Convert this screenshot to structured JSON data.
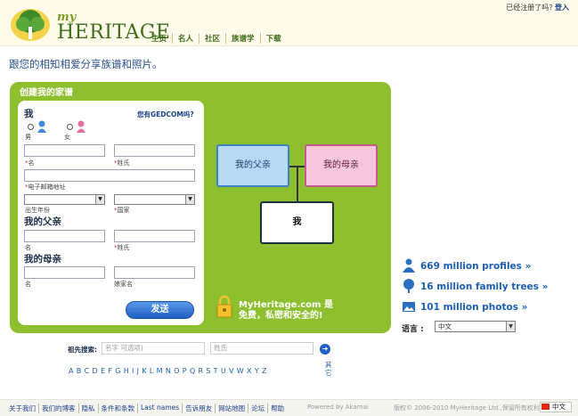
{
  "header": {
    "logo_my": "my",
    "logo_heritage": "HERITAGE",
    "nav": [
      "主页",
      "名人",
      "社区",
      "族谱学",
      "下载"
    ],
    "account_question": "已经注册了吗?",
    "login": "登入"
  },
  "tagline": "跟您的相知相爱分享族谱和照片。",
  "panel": {
    "title": "创建我的家谱",
    "gedcom_link": "您有GEDCOM吗?",
    "me_heading": "我",
    "male": "男",
    "female": "女",
    "first_name": "名",
    "last_name": "姓氏",
    "email": "电子邮箱地址",
    "birth_year": "出生年份",
    "country": "国家",
    "father_heading": "我的父亲",
    "father_first": "名",
    "father_last": "姓氏",
    "mother_heading": "我的母亲",
    "mother_first": "名",
    "mother_last": "娘家名",
    "submit": "发送"
  },
  "tree": {
    "father": "我的父亲",
    "mother": "我的母亲",
    "me": "我"
  },
  "security": {
    "line1": "MyHeritage.com 是",
    "line2": "免费，私密和安全的!"
  },
  "stats": [
    {
      "icon": "person-icon",
      "text": "669 million profiles »"
    },
    {
      "icon": "tree-icon",
      "text": "16 million family trees »"
    },
    {
      "icon": "photo-icon",
      "text": "101 million photos »"
    }
  ],
  "language": {
    "label": "语言 :",
    "selected": "中文"
  },
  "search": {
    "label": "祖先搜索:",
    "first_placeholder": "名字 可选项)",
    "last_placeholder": "姓氏",
    "letters": [
      "A",
      "B",
      "C",
      "D",
      "E",
      "F",
      "G",
      "H",
      "I",
      "J",
      "K",
      "L",
      "M",
      "N",
      "O",
      "P",
      "Q",
      "R",
      "S",
      "T",
      "U",
      "V",
      "W",
      "X",
      "Y",
      "Z"
    ],
    "other": "其它"
  },
  "footer": {
    "links": [
      "关于我们",
      "我们的博客",
      "隐私",
      "条件和条款",
      "Last names",
      "告诉朋友",
      "网站地图",
      "论坛",
      "帮助"
    ],
    "powered": "Powered by Akamai",
    "copyright": "版权© 2006-2010 MyHeritage Ltd.,保留所有权利",
    "lang": "中文"
  },
  "colors": {
    "panel_green": "#8dbf2e",
    "link_blue": "#1c5fb0",
    "father_blue": "#b9d8f4",
    "mother_pink": "#f6c6dc"
  }
}
